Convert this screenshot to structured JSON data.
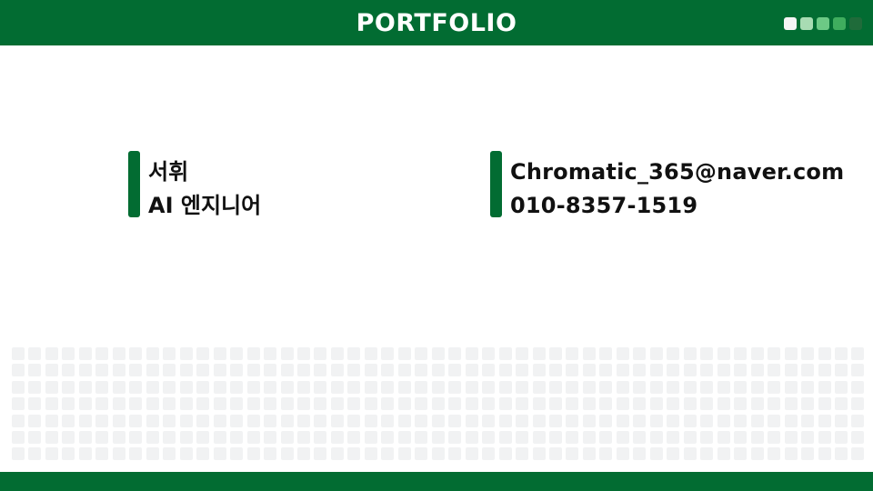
{
  "header": {
    "title": "PORTFOLIO",
    "dot_colors": [
      "#f5f5f5",
      "#a8dcb3",
      "#6cc985",
      "#3fad5e",
      "#1f6b3a"
    ]
  },
  "profile": {
    "name": "서휘",
    "role": "AI 엔지니어"
  },
  "contact": {
    "email": "Chromatic_365@naver.com",
    "phone": "010-8357-1519"
  },
  "colors": {
    "brand_green": "#026c32",
    "pattern_gray": "#f1f2f3"
  }
}
